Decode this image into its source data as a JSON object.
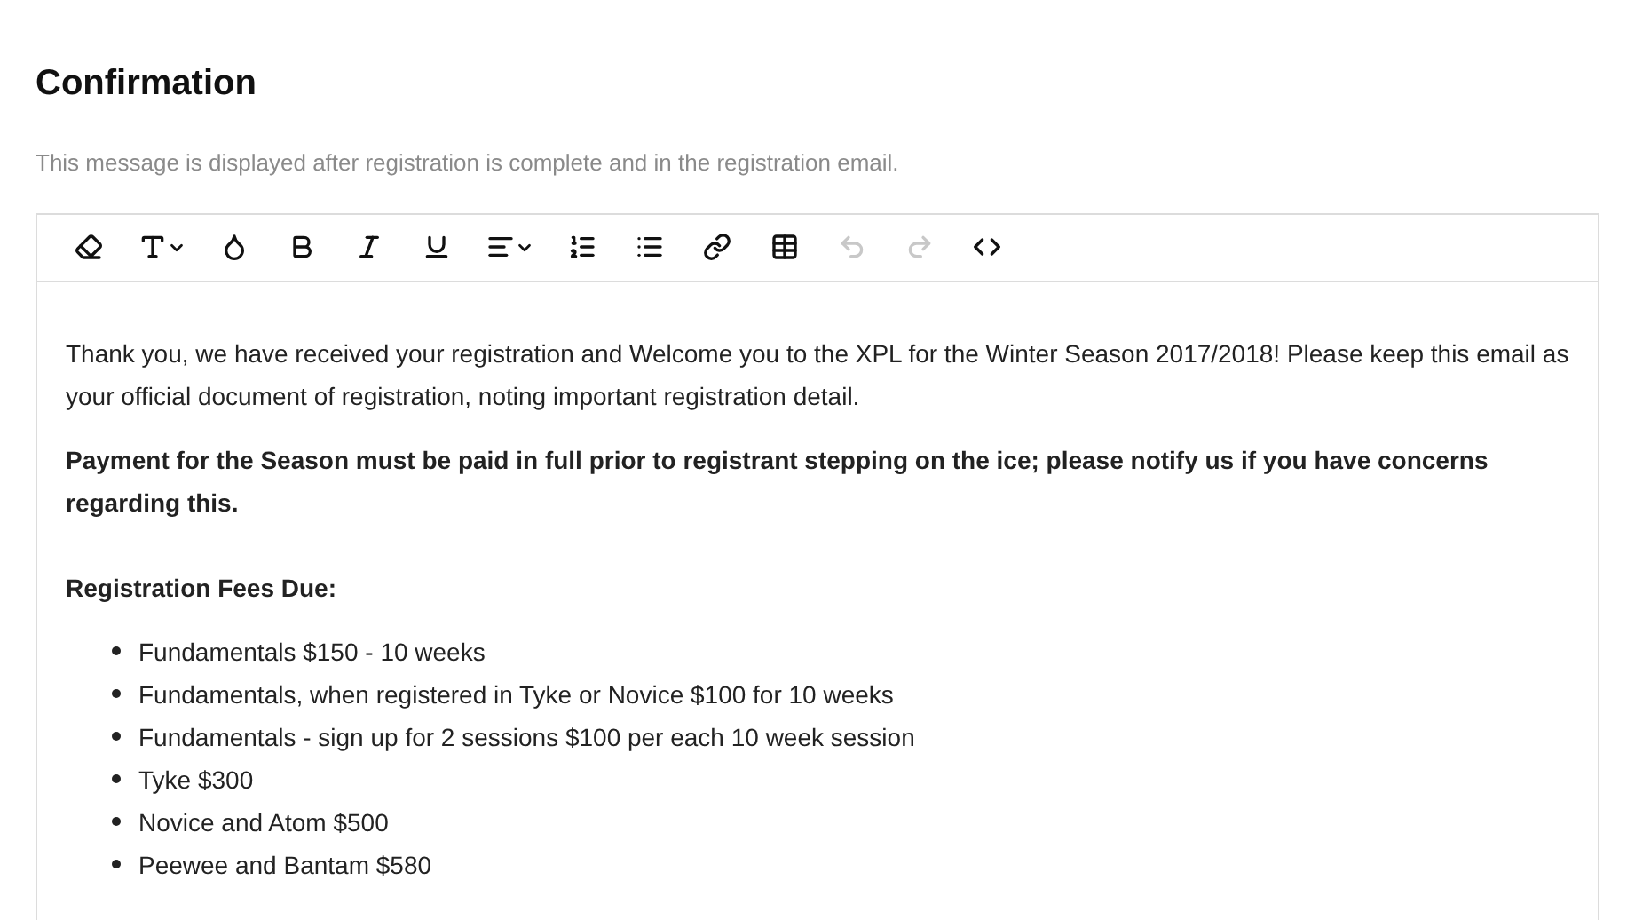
{
  "title": "Confirmation",
  "description": "This message is displayed after registration is complete and in the registration email.",
  "toolbar": [
    {
      "kind": "eraser",
      "disabled": false,
      "dropdown": false
    },
    {
      "kind": "font-size",
      "disabled": false,
      "dropdown": true
    },
    {
      "kind": "color",
      "disabled": false,
      "dropdown": false
    },
    {
      "kind": "bold",
      "disabled": false,
      "dropdown": false
    },
    {
      "kind": "italic",
      "disabled": false,
      "dropdown": false
    },
    {
      "kind": "underline",
      "disabled": false,
      "dropdown": false
    },
    {
      "kind": "align",
      "disabled": false,
      "dropdown": true
    },
    {
      "kind": "ordered-list",
      "disabled": false,
      "dropdown": false
    },
    {
      "kind": "bullet-list",
      "disabled": false,
      "dropdown": false
    },
    {
      "kind": "link",
      "disabled": false,
      "dropdown": false
    },
    {
      "kind": "table",
      "disabled": false,
      "dropdown": false
    },
    {
      "kind": "undo",
      "disabled": true,
      "dropdown": false
    },
    {
      "kind": "redo",
      "disabled": true,
      "dropdown": false
    },
    {
      "kind": "code",
      "disabled": false,
      "dropdown": false
    }
  ],
  "content": [
    {
      "kind": "paragraph",
      "text": "Thank you, we have received your registration and Welcome you to the XPL for the Winter Season 2017/2018!  Please keep this email as your official document of registration, noting important registration detail."
    },
    {
      "kind": "bold",
      "text": "Payment for the Season must be paid in full prior to registrant stepping on the ice; please notify us if you have concerns regarding this."
    },
    {
      "kind": "spacer"
    },
    {
      "kind": "bold",
      "text": "Registration Fees Due:"
    },
    {
      "kind": "list",
      "items": [
        "Fundamentals $150 - 10 weeks",
        "Fundamentals, when registered in Tyke or Novice $100 for 10 weeks",
        "Fundamentals - sign up for 2 sessions $100 per each 10 week session",
        "Tyke $300",
        "Novice and Atom $500",
        "Peewee and Bantam $580"
      ]
    }
  ]
}
